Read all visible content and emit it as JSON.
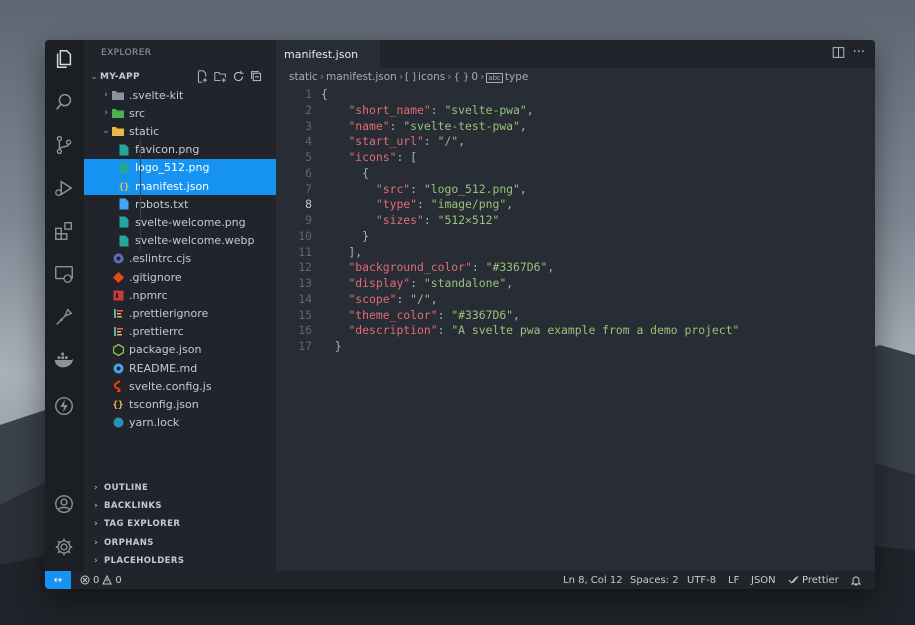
{
  "colors": {
    "accent": "#1692f2",
    "editor_bg": "#282c34",
    "sidebar_bg": "#21252b",
    "key": "#e06c75",
    "string": "#98c379"
  },
  "activity_bar": [
    {
      "name": "explorer-icon"
    },
    {
      "name": "search-icon"
    },
    {
      "name": "source-control-icon"
    },
    {
      "name": "run-debug-icon"
    },
    {
      "name": "extensions-icon"
    },
    {
      "name": "remote-explorer-icon"
    },
    {
      "name": "git-graph-icon"
    },
    {
      "name": "docker-icon"
    },
    {
      "name": "lightning-icon"
    },
    {
      "name": "account-icon"
    },
    {
      "name": "settings-gear-icon"
    }
  ],
  "sidebar": {
    "title": "EXPLORER",
    "more": "···",
    "root": "MY-APP",
    "tree": [
      {
        "label": ".svelte-kit",
        "depth": 1,
        "chev": "›",
        "icon": "folder-icon",
        "color": "#8a94a0"
      },
      {
        "label": "src",
        "depth": 1,
        "chev": "›",
        "icon": "folder-src-icon",
        "color": "#4caf50"
      },
      {
        "label": "static",
        "depth": 1,
        "chev": "⌄",
        "icon": "folder-open-icon",
        "color": "#e8b84a"
      },
      {
        "label": "favicon.png",
        "depth": 2,
        "icon": "image-file-icon",
        "color": "#26a69a"
      },
      {
        "label": "logo_512.png",
        "depth": 2,
        "icon": "image-file-icon",
        "color": "#26a69a",
        "selected": true
      },
      {
        "label": "manifest.json",
        "depth": 2,
        "icon": "json-file-icon",
        "color": "#f5c542",
        "selected": true
      },
      {
        "label": "robots.txt",
        "depth": 2,
        "icon": "text-file-icon",
        "color": "#42a5f5"
      },
      {
        "label": "svelte-welcome.png",
        "depth": 2,
        "icon": "image-file-icon",
        "color": "#26a69a"
      },
      {
        "label": "svelte-welcome.webp",
        "depth": 2,
        "icon": "image-file-icon",
        "color": "#26a69a"
      },
      {
        "label": ".eslintrc.cjs",
        "depth": 1,
        "icon": "eslint-icon",
        "color": "#5c6bc0"
      },
      {
        "label": ".gitignore",
        "depth": 1,
        "icon": "git-icon",
        "color": "#e64a19"
      },
      {
        "label": ".npmrc",
        "depth": 1,
        "icon": "npm-icon",
        "color": "#cb3837"
      },
      {
        "label": ".prettierignore",
        "depth": 1,
        "icon": "prettier-icon",
        "color": "#c9b574"
      },
      {
        "label": ".prettierrc",
        "depth": 1,
        "icon": "prettier-icon",
        "color": "#c9b574"
      },
      {
        "label": "package.json",
        "depth": 1,
        "icon": "nodejs-icon",
        "color": "#8bc34a"
      },
      {
        "label": "README.md",
        "depth": 1,
        "icon": "info-icon",
        "color": "#42a5f5"
      },
      {
        "label": "svelte.config.js",
        "depth": 1,
        "icon": "svelte-icon",
        "color": "#ff3e00"
      },
      {
        "label": "tsconfig.json",
        "depth": 1,
        "icon": "json-file-icon",
        "color": "#f5c542"
      },
      {
        "label": "yarn.lock",
        "depth": 1,
        "icon": "yarn-icon",
        "color": "#2c8ebb"
      }
    ],
    "sections": [
      "OUTLINE",
      "BACKLINKS",
      "TAG EXPLORER",
      "ORPHANS",
      "PLACEHOLDERS"
    ]
  },
  "editor": {
    "tab": "manifest.json",
    "breadcrumb": [
      {
        "label": "static",
        "icon": ""
      },
      {
        "label": "manifest.json",
        "icon": ""
      },
      {
        "label": "icons",
        "icon": "[ ]"
      },
      {
        "label": "0",
        "icon": "{ }"
      },
      {
        "label": "type",
        "icon": "abc"
      }
    ],
    "current_line": 8,
    "lines": [
      [
        [
          "p",
          "{"
        ]
      ],
      [
        [
          "p",
          "    "
        ],
        [
          "k",
          "\"short_name\""
        ],
        [
          "p",
          ": "
        ],
        [
          "s",
          "\"svelte-pwa\""
        ],
        [
          "p",
          ","
        ]
      ],
      [
        [
          "p",
          "    "
        ],
        [
          "k",
          "\"name\""
        ],
        [
          "p",
          ": "
        ],
        [
          "s",
          "\"svelte-test-pwa\""
        ],
        [
          "p",
          ","
        ]
      ],
      [
        [
          "p",
          "    "
        ],
        [
          "k",
          "\"start_url\""
        ],
        [
          "p",
          ": "
        ],
        [
          "s",
          "\"/\""
        ],
        [
          "p",
          ","
        ]
      ],
      [
        [
          "p",
          "    "
        ],
        [
          "k",
          "\"icons\""
        ],
        [
          "p",
          ": ["
        ]
      ],
      [
        [
          "p",
          "      {"
        ]
      ],
      [
        [
          "p",
          "        "
        ],
        [
          "k",
          "\"src\""
        ],
        [
          "p",
          ": "
        ],
        [
          "s",
          "\"logo_512.png\""
        ],
        [
          "p",
          ","
        ]
      ],
      [
        [
          "p",
          "        "
        ],
        [
          "k",
          "\"type\""
        ],
        [
          "p",
          ": "
        ],
        [
          "s",
          "\"image/png\""
        ],
        [
          "p",
          ","
        ]
      ],
      [
        [
          "p",
          "        "
        ],
        [
          "k",
          "\"sizes\""
        ],
        [
          "p",
          ": "
        ],
        [
          "s",
          "\"512×512\""
        ]
      ],
      [
        [
          "p",
          "      }"
        ]
      ],
      [
        [
          "p",
          "    ],"
        ]
      ],
      [
        [
          "p",
          "    "
        ],
        [
          "k",
          "\"background_color\""
        ],
        [
          "p",
          ": "
        ],
        [
          "s",
          "\"#3367D6\""
        ],
        [
          "p",
          ","
        ]
      ],
      [
        [
          "p",
          "    "
        ],
        [
          "k",
          "\"display\""
        ],
        [
          "p",
          ": "
        ],
        [
          "s",
          "\"standalone\""
        ],
        [
          "p",
          ","
        ]
      ],
      [
        [
          "p",
          "    "
        ],
        [
          "k",
          "\"scope\""
        ],
        [
          "p",
          ": "
        ],
        [
          "s",
          "\"/\""
        ],
        [
          "p",
          ","
        ]
      ],
      [
        [
          "p",
          "    "
        ],
        [
          "k",
          "\"theme_color\""
        ],
        [
          "p",
          ": "
        ],
        [
          "s",
          "\"#3367D6\""
        ],
        [
          "p",
          ","
        ]
      ],
      [
        [
          "p",
          "    "
        ],
        [
          "k",
          "\"description\""
        ],
        [
          "p",
          ": "
        ],
        [
          "s",
          "\"A svelte pwa example from a demo project\""
        ]
      ],
      [
        [
          "p",
          "  }"
        ]
      ]
    ]
  },
  "status": {
    "remote_icon": "↔",
    "errors": "0",
    "warnings": "0",
    "position": "Ln 8, Col 12",
    "spaces": "Spaces: 2",
    "encoding": "UTF-8",
    "eol": "LF",
    "language": "JSON",
    "formatter": "Prettier"
  }
}
